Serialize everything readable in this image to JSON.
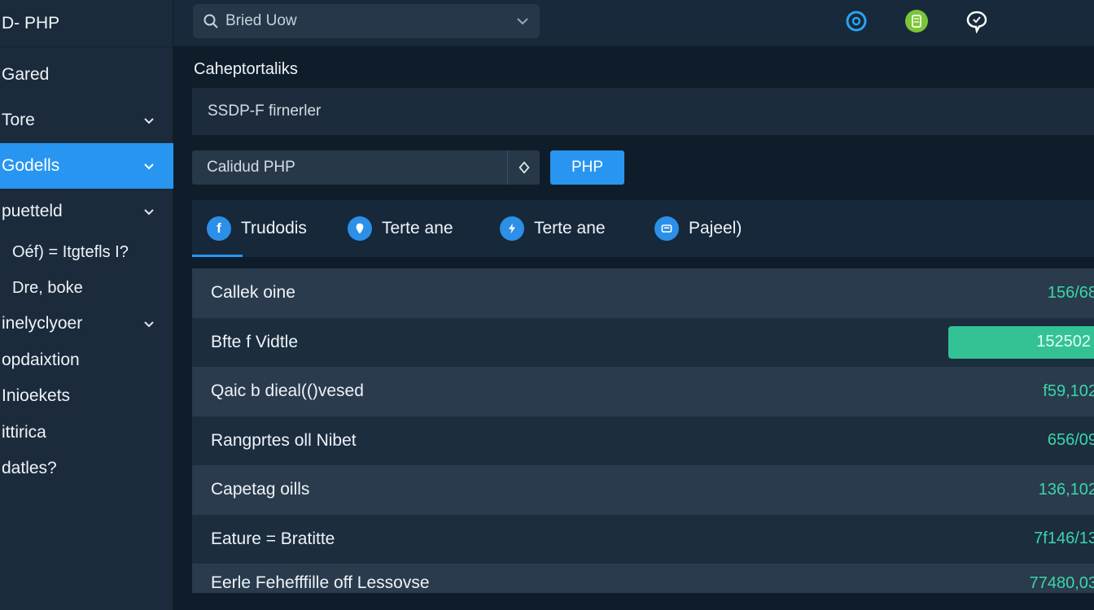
{
  "app": {
    "title": "D- PHP"
  },
  "search": {
    "value": "Bried Uow"
  },
  "colors": {
    "accent": "#2896f0",
    "value_green": "#3ad6a8",
    "highlight": "#34c294",
    "top_icon_blue": "#2aa3f0",
    "top_icon_green": "#7cc53a"
  },
  "top_icons": [
    "refresh-circle-icon",
    "app-badge-icon",
    "chat-bubble-icon"
  ],
  "sidebar": {
    "items": [
      {
        "label": "Gared"
      },
      {
        "label": "Tore"
      },
      {
        "label": "Godells"
      },
      {
        "label": "puetteld"
      },
      {
        "label": "Oéf) = Itgtefls I?"
      },
      {
        "label": "Dre, boke"
      },
      {
        "label": "inelyclyoer"
      },
      {
        "label": "opdaixtion"
      },
      {
        "label": "Inioekets"
      },
      {
        "label": "ittirica"
      },
      {
        "label": "datles?"
      }
    ]
  },
  "main": {
    "title": "Caheptortaliks",
    "filter_text": "SSDP-F firnerler",
    "php_input_value": "Calidud PHP",
    "php_button": "PHP",
    "tabs": [
      {
        "label": "Trudodis",
        "icon": "f"
      },
      {
        "label": "Terte ane",
        "icon": "pin"
      },
      {
        "label": "Terte ane",
        "icon": "bolt"
      },
      {
        "label": "Pajeel)",
        "icon": "box"
      }
    ],
    "rows": [
      {
        "label": "Callek oine",
        "value": "156/68"
      },
      {
        "label": "Bfte f Vidtle",
        "value": "152502"
      },
      {
        "label": "Qaic b dieal(()vesed",
        "value": "f59,102"
      },
      {
        "label": "Rangprtes oll Nibet",
        "value": "656/09"
      },
      {
        "label": "Capetag oills",
        "value": "136,102"
      },
      {
        "label": "Eature = Bratitte",
        "value": "7f146/13"
      },
      {
        "label": "Eerle Fehefffille off Lessovse",
        "value": "77480,03"
      }
    ]
  }
}
